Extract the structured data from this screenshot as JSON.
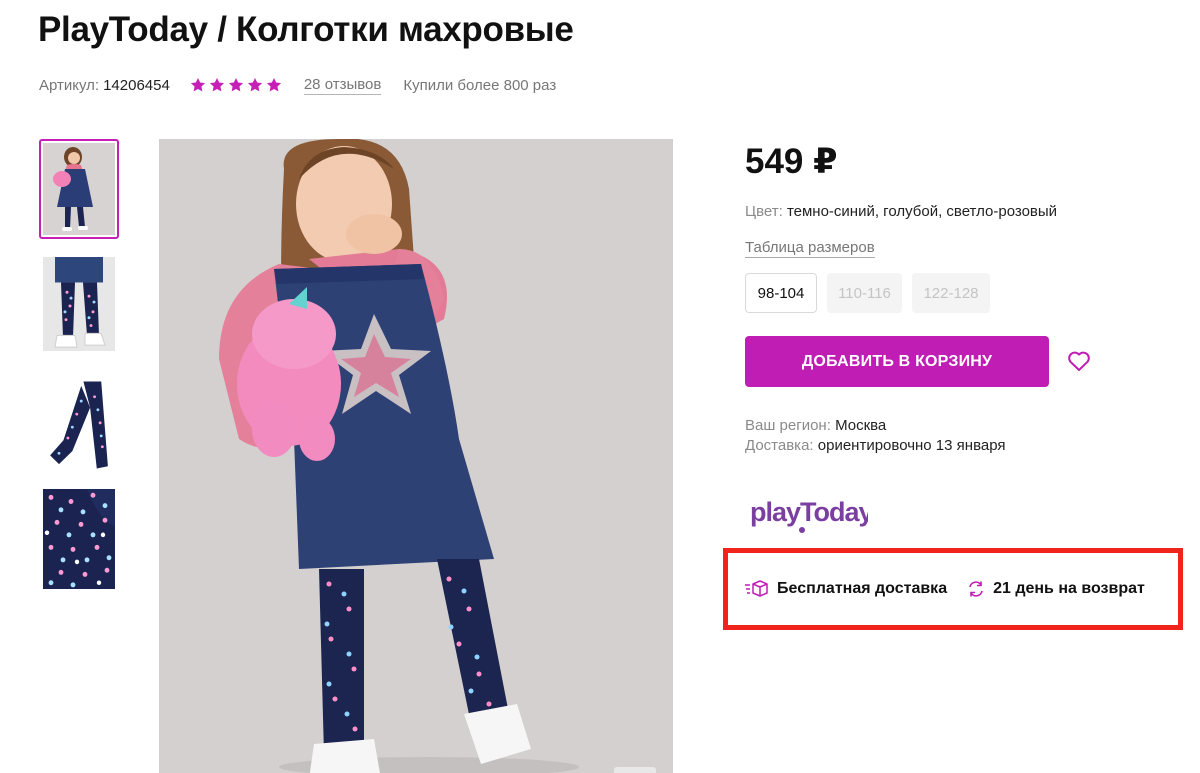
{
  "product": {
    "title": "PlayToday / Колготки махровые",
    "sku_label": "Артикул:",
    "sku": "14206454",
    "rating_stars": 5,
    "reviews": "28 отзывов",
    "bought": "Купили более 800 раз"
  },
  "gallery": {
    "thumbnails": [
      "girl-full-outfit",
      "legs-dotted-tights",
      "folded-tights",
      "dot-fabric-closeup"
    ],
    "active_index": 0
  },
  "buy": {
    "price": "549 ₽",
    "color_label": "Цвет:",
    "color_value": "темно-синий, голубой, светло-розовый",
    "size_table": "Таблица размеров",
    "sizes": [
      {
        "label": "98-104",
        "available": true,
        "selected": true
      },
      {
        "label": "110-116",
        "available": false
      },
      {
        "label": "122-128",
        "available": false
      }
    ],
    "add_to_cart": "ДОБАВИТЬ В КОРЗИНУ",
    "favorite_icon": "heart-icon"
  },
  "delivery": {
    "region_label": "Ваш регион:",
    "region_value": "Москва",
    "delivery_label": "Доставка:",
    "delivery_value": "ориентировочно 13 января"
  },
  "brand": {
    "name": "playToday"
  },
  "perks": {
    "free_delivery": "Бесплатная доставка",
    "returns": "21 день на возврат"
  },
  "colors": {
    "accent": "#c01db4",
    "highlight": "#f1241c",
    "star": "#c51fb6"
  }
}
